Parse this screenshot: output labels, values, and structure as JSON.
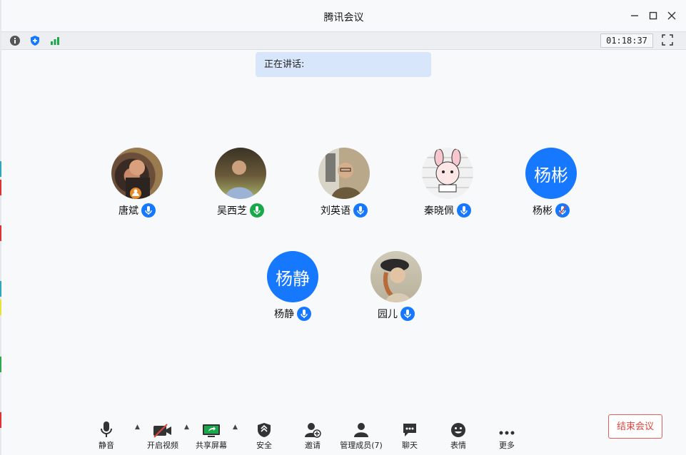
{
  "window": {
    "title": "腾讯会议"
  },
  "topbar": {
    "timer": "01:18:37"
  },
  "speaking": {
    "label": "正在讲话:"
  },
  "members": [
    {
      "name": "唐斌",
      "avatar_type": "photo",
      "host": true,
      "mic": "blue"
    },
    {
      "name": "吴西芝",
      "avatar_type": "photo",
      "mic": "green"
    },
    {
      "name": "刘英语",
      "avatar_type": "photo",
      "mic": "blue"
    },
    {
      "name": "秦晓佩",
      "avatar_type": "photo",
      "mic": "blue"
    },
    {
      "name": "杨彬",
      "avatar_text": "杨彬",
      "mic": "muted"
    },
    {
      "name": "杨静",
      "avatar_text": "杨静",
      "mic": "blue"
    },
    {
      "name": "园儿",
      "avatar_type": "photo",
      "mic": "blue"
    }
  ],
  "bottom": {
    "mute": "静音",
    "video": "开启视频",
    "share": "共享屏幕",
    "security": "安全",
    "invite": "邀请",
    "manage": "管理成员(7)",
    "chat": "聊天",
    "emoji": "表情",
    "more": "更多",
    "end": "结束会议"
  },
  "colors": {
    "accent": "#1677ff",
    "end": "#e0443e",
    "signal": "#1aa94a"
  }
}
